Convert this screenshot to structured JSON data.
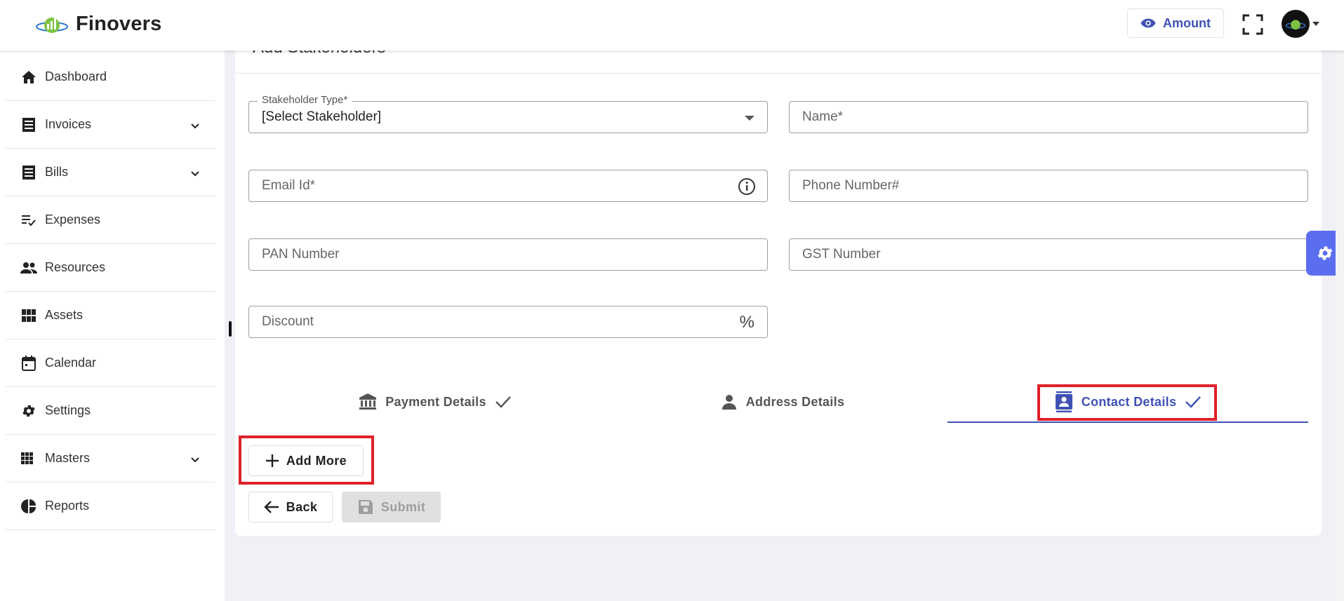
{
  "app": {
    "name": "Finovers"
  },
  "header": {
    "amount_label": "Amount"
  },
  "sidebar": {
    "items": [
      {
        "label": "Dashboard"
      },
      {
        "label": "Invoices"
      },
      {
        "label": "Bills"
      },
      {
        "label": "Expenses"
      },
      {
        "label": "Resources"
      },
      {
        "label": "Assets"
      },
      {
        "label": "Calendar"
      },
      {
        "label": "Settings"
      },
      {
        "label": "Masters"
      },
      {
        "label": "Reports"
      }
    ]
  },
  "form": {
    "title": "Add Stakeholders",
    "stakeholder_type": {
      "label": "Stakeholder Type*",
      "value": "[Select Stakeholder]"
    },
    "name": {
      "placeholder": "Name*"
    },
    "email": {
      "placeholder": "Email Id*"
    },
    "phone": {
      "placeholder": "Phone Number#"
    },
    "pan": {
      "placeholder": "PAN Number"
    },
    "gst": {
      "placeholder": "GST Number"
    },
    "discount": {
      "placeholder": "Discount",
      "suffix": "%"
    }
  },
  "tabs": [
    {
      "label": "Payment Details"
    },
    {
      "label": "Address Details"
    },
    {
      "label": "Contact Details"
    }
  ],
  "actions": {
    "add_more": "Add More",
    "back": "Back",
    "submit": "Submit"
  },
  "colors": {
    "accent": "#3f51b5",
    "highlight": "#e0202a",
    "fab": "#5c6ef0"
  }
}
